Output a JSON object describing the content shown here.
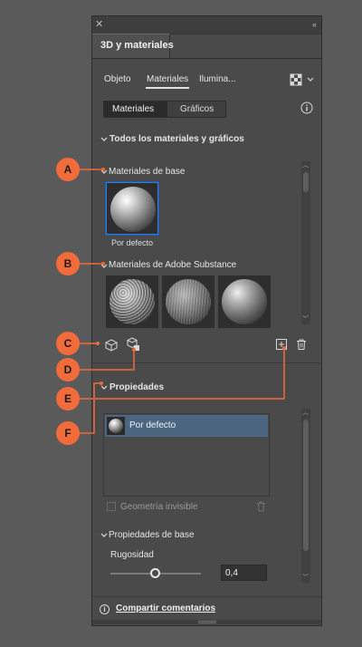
{
  "panel": {
    "close_glyph": "✕",
    "collapse_glyph": "‹‹",
    "title": "3D y materiales"
  },
  "tabs": [
    {
      "label": "Objeto"
    },
    {
      "label": "Materiales",
      "active": true
    },
    {
      "label": "Ilumina..."
    }
  ],
  "subtabs": {
    "materiales": "Materiales",
    "graficos": "Gráficos"
  },
  "section_all": "Todos los materiales y gráficos",
  "base_materials": {
    "heading": "Materiales de base",
    "items": [
      {
        "label": "Por defecto",
        "selected": true
      }
    ]
  },
  "substance": {
    "heading": "Materiales de Adobe Substance",
    "items": [
      "texture-1",
      "texture-2",
      "texture-3"
    ]
  },
  "properties": {
    "heading": "Propiedades",
    "selected_item": "Por defecto",
    "invisible_geometry": "Geometría invisible",
    "base_heading": "Propiedades de base",
    "roughness_label": "Rugosidad",
    "roughness_value": "0,4",
    "roughness_fraction": 0.4
  },
  "footer": {
    "info_glyph": "i",
    "share": "Compartir comentarios"
  },
  "callouts": [
    "A",
    "B",
    "C",
    "D",
    "E",
    "F"
  ],
  "accent_color": "#f26b3a",
  "selection_color": "#4c6580"
}
